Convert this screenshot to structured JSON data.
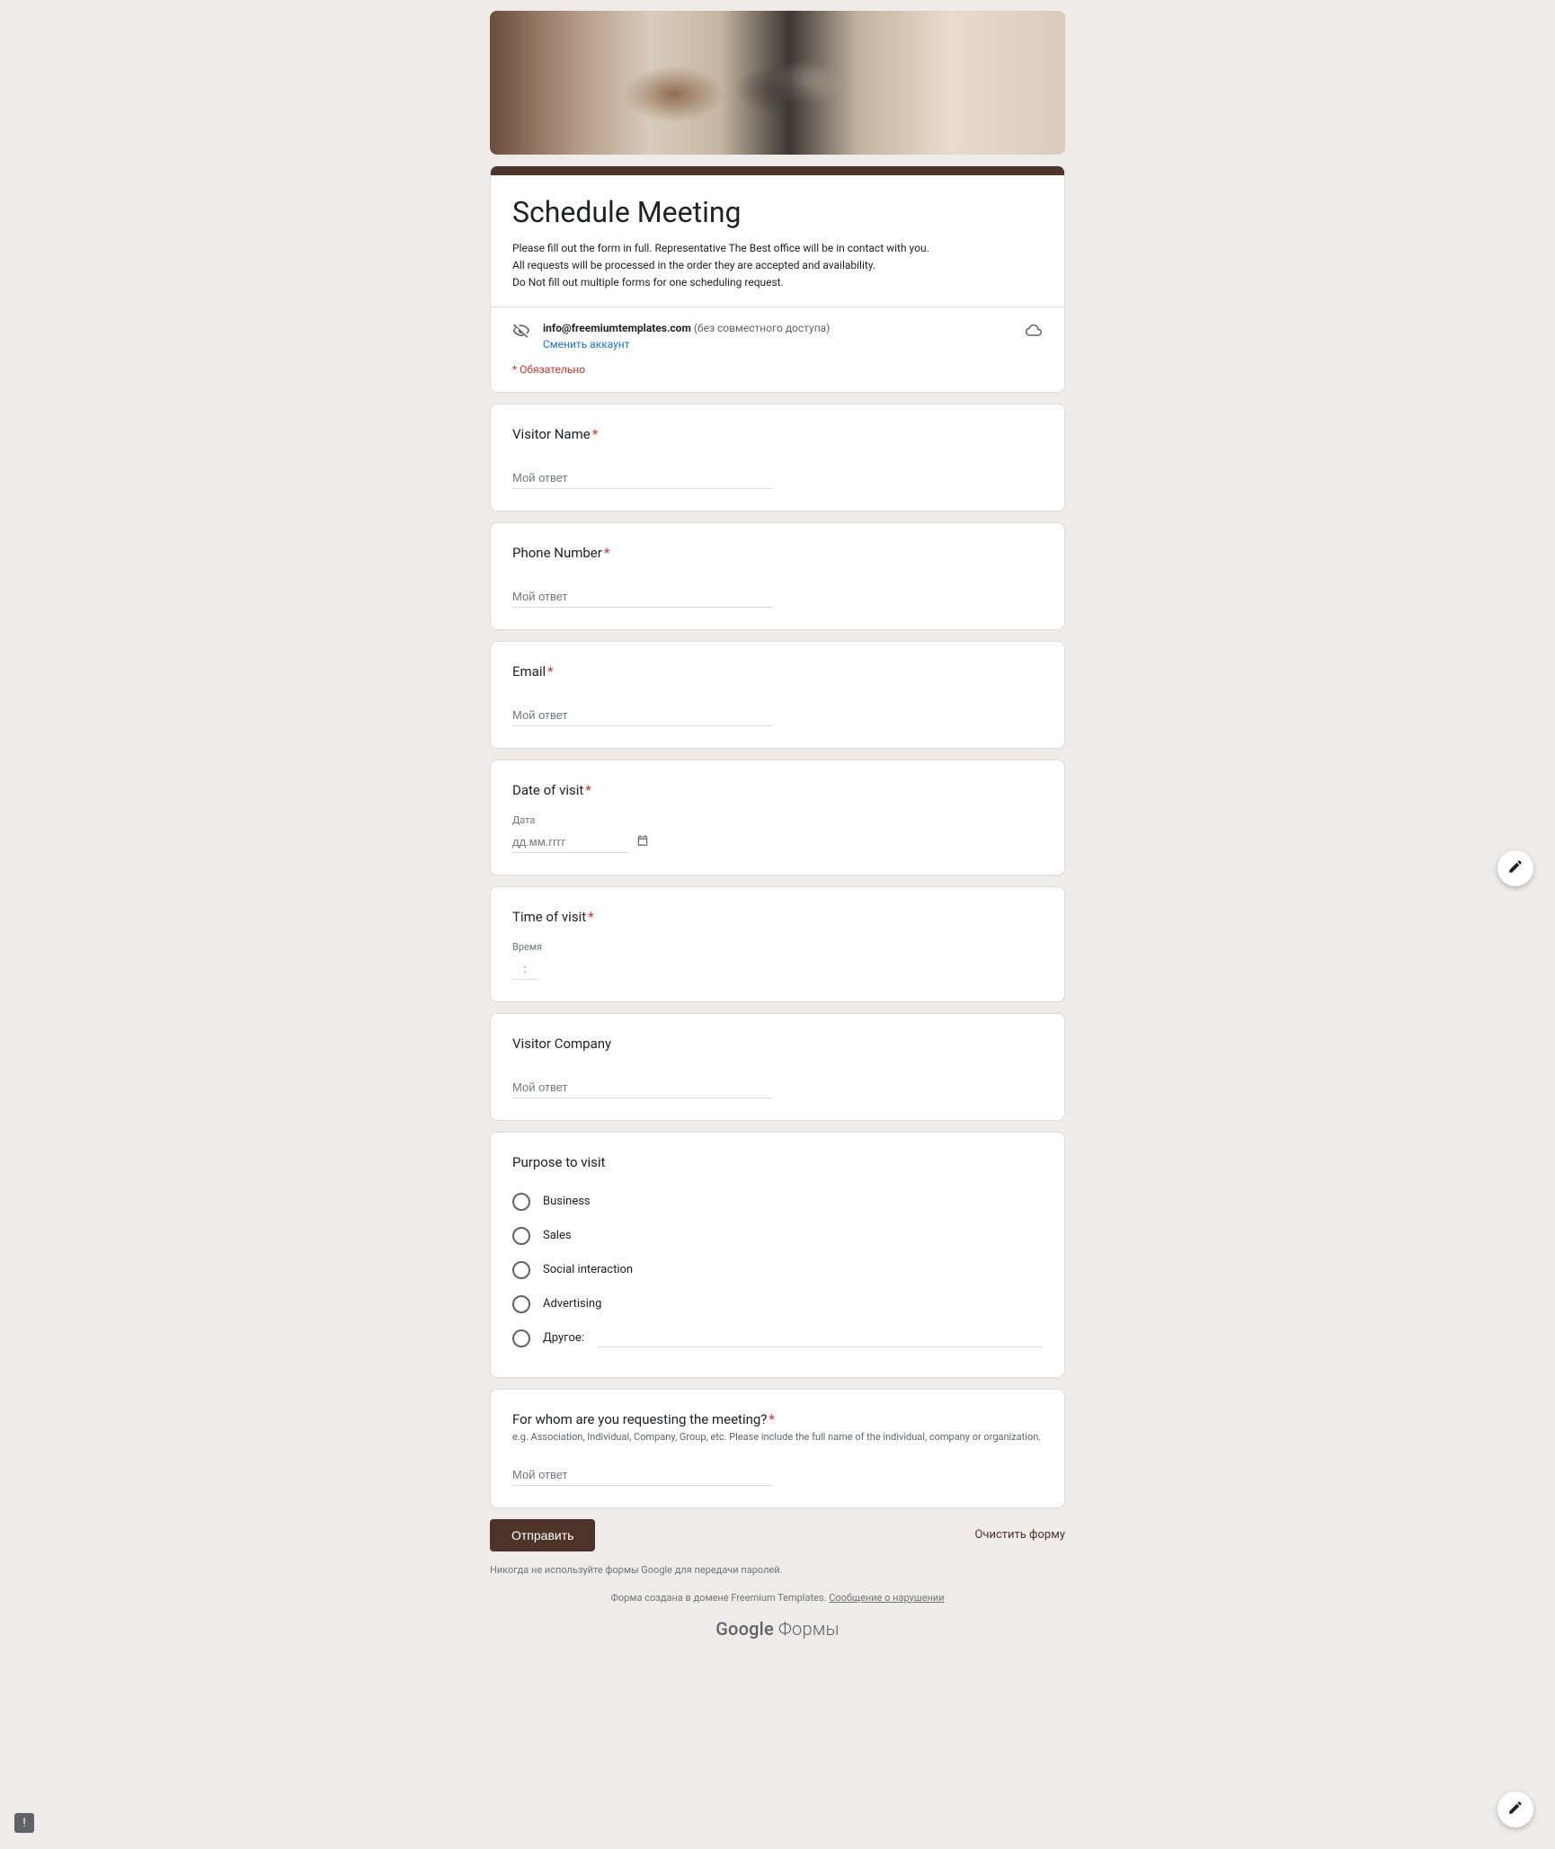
{
  "header": {
    "title": "Schedule Meeting",
    "description": "Please fill out the form in full. Representative The Best office will be in contact with you.\nAll requests will be processed in the order they are accepted and availability.\nDo Not fill out multiple forms for one scheduling request."
  },
  "account": {
    "email": "info@freemiumtemplates.com",
    "sharing_suffix": "(без совместного доступа)",
    "switch_label": "Сменить аккаунт"
  },
  "required_note": "* Обязательно",
  "placeholders": {
    "text_answer": "Мой ответ",
    "date": "дд.мм.гггг",
    "time_colon": ":"
  },
  "questions": {
    "visitor_name": {
      "label": "Visitor Name",
      "required": true
    },
    "phone": {
      "label": "Phone Number",
      "required": true
    },
    "email": {
      "label": "Email",
      "required": true
    },
    "date_of_visit": {
      "label": "Date of visit",
      "required": true,
      "sub_label": "Дата"
    },
    "time_of_visit": {
      "label": "Time of visit",
      "required": true,
      "sub_label": "Время"
    },
    "visitor_company": {
      "label": "Visitor Company",
      "required": false
    },
    "purpose": {
      "label": "Purpose to visit",
      "required": false,
      "options": [
        "Business",
        "Sales",
        "Social interaction",
        "Advertising"
      ],
      "other_label": "Другое:"
    },
    "for_whom": {
      "label": "For whom are you requesting the meeting?",
      "required": true,
      "description": "e.g. Association, Individual, Company, Group, etc. Please include the full name of the individual, company or organization."
    }
  },
  "actions": {
    "submit": "Отправить",
    "clear": "Очистить форму"
  },
  "footer": {
    "warning": "Никогда не используйте формы Google для передачи паролей.",
    "domain_prefix": "Форма создана в домене Freemium Templates. ",
    "report": "Сообщение о нарушении",
    "brand_google": "Google",
    "brand_forms": " Формы"
  },
  "chip_text": "!"
}
